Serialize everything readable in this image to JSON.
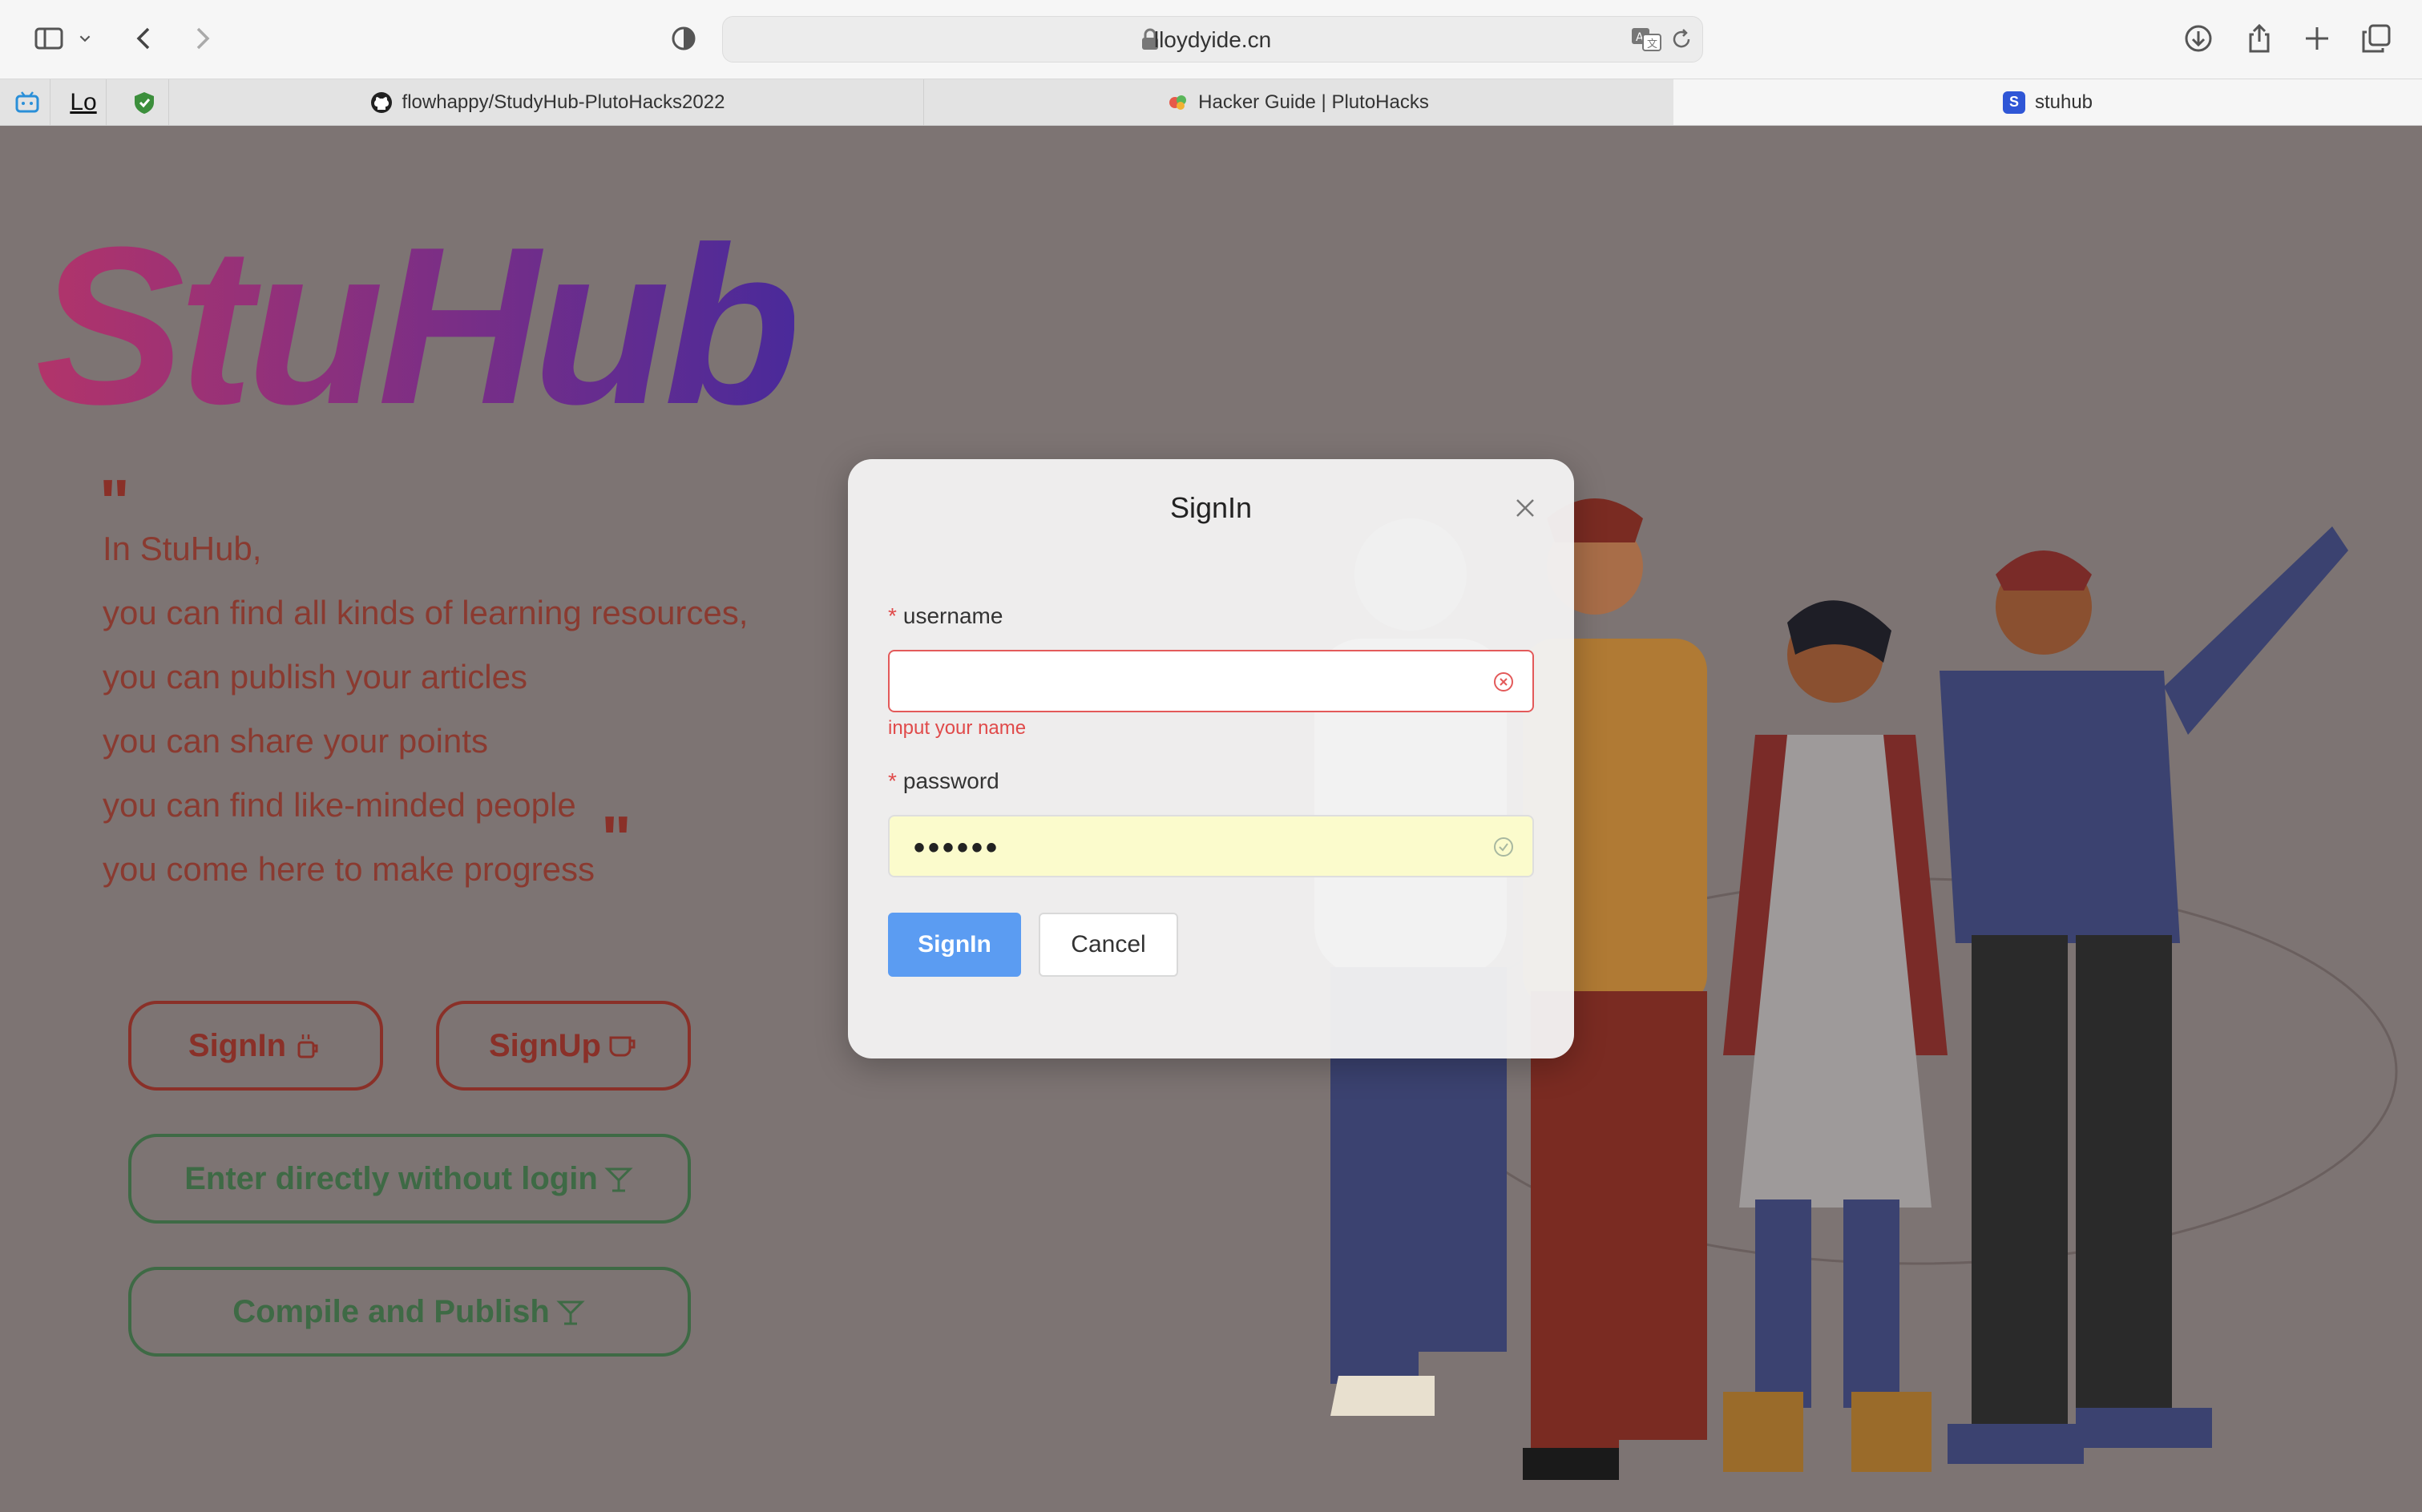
{
  "browser": {
    "url": "lloydyide.cn",
    "tabs": [
      {
        "title": "flowhappy/StudyHub-PlutoHacks2022",
        "icon": "github-icon"
      },
      {
        "title": "Hacker Guide | PlutoHacks",
        "icon": "plutohacks-icon"
      },
      {
        "title": "stuhub",
        "icon": "stuhub-icon",
        "favicon_letter": "S"
      }
    ],
    "pinned_tabs": [
      {
        "icon": "bilibili-icon"
      },
      {
        "label": "Lo"
      },
      {
        "icon": "shield-icon"
      }
    ]
  },
  "page": {
    "logo": "StuHub",
    "open_quote": "\"",
    "close_quote": "\"",
    "intro_lines": [
      "In StuHub,",
      "you can find all kinds of learning resources,",
      "you can publish your articles",
      "you can share your points",
      "you can find like-minded people",
      "you come here to make progress"
    ],
    "buttons": {
      "signin": "SignIn",
      "signup": "SignUp",
      "enter": "Enter directly without login",
      "publish": "Compile and Publish"
    }
  },
  "modal": {
    "title": "SignIn",
    "username_label": "username",
    "username_value": "",
    "username_error": "input your name",
    "password_label": "password",
    "password_value": "••••••",
    "signin_button": "SignIn",
    "cancel_button": "Cancel"
  },
  "colors": {
    "overlay": "#7d7473",
    "primary": "#5b9cf2",
    "error": "#e04a4a",
    "intro_text": "#8a3a30",
    "green_button": "#3e6a45"
  }
}
